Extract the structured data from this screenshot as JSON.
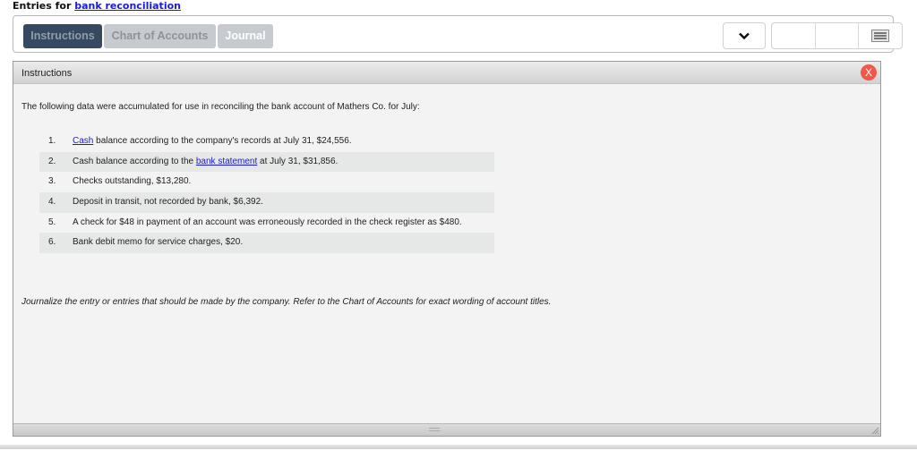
{
  "header": {
    "title_prefix": "Entries for ",
    "title_link": "bank reconciliation"
  },
  "tabs": [
    {
      "label": "Instructions",
      "active": true
    },
    {
      "label": "Chart of Accounts",
      "active": false
    },
    {
      "label": "Journal",
      "active": false
    }
  ],
  "toolbar": {
    "dropdown_icon": "chevron-down-icon",
    "menu_icon": "list-menu-icon"
  },
  "panel": {
    "title": "Instructions",
    "close_label": "X",
    "intro": "The following data were accumulated for use in reconciling the bank account of Mathers Co. for July:",
    "items": [
      {
        "num": "1.",
        "link": "Cash",
        "before": "",
        "after": " balance according to the company's records at July 31, $24,556."
      },
      {
        "num": "2.",
        "before": "Cash balance according to the ",
        "link": "bank statement",
        "after": " at July 31, $31,856."
      },
      {
        "num": "3.",
        "before": "Checks outstanding, $13,280.",
        "link": "",
        "after": ""
      },
      {
        "num": "4.",
        "before": "Deposit in transit, not recorded by bank, $6,392.",
        "link": "",
        "after": ""
      },
      {
        "num": "5.",
        "before": "A check for $48 in payment of an account was erroneously recorded in the check register as $480.",
        "link": "",
        "after": ""
      },
      {
        "num": "6.",
        "before": "Bank debit memo for service charges, $20.",
        "link": "",
        "after": ""
      }
    ],
    "journalize": "Journalize the entry or entries that should be made by the company. Refer to the Chart of Accounts for exact wording of account titles."
  },
  "colors": {
    "active_tab": "#354a61",
    "inactive_tab": "#c7cbcf",
    "close_button": "#f0594a",
    "link": "#1a1ad6"
  }
}
